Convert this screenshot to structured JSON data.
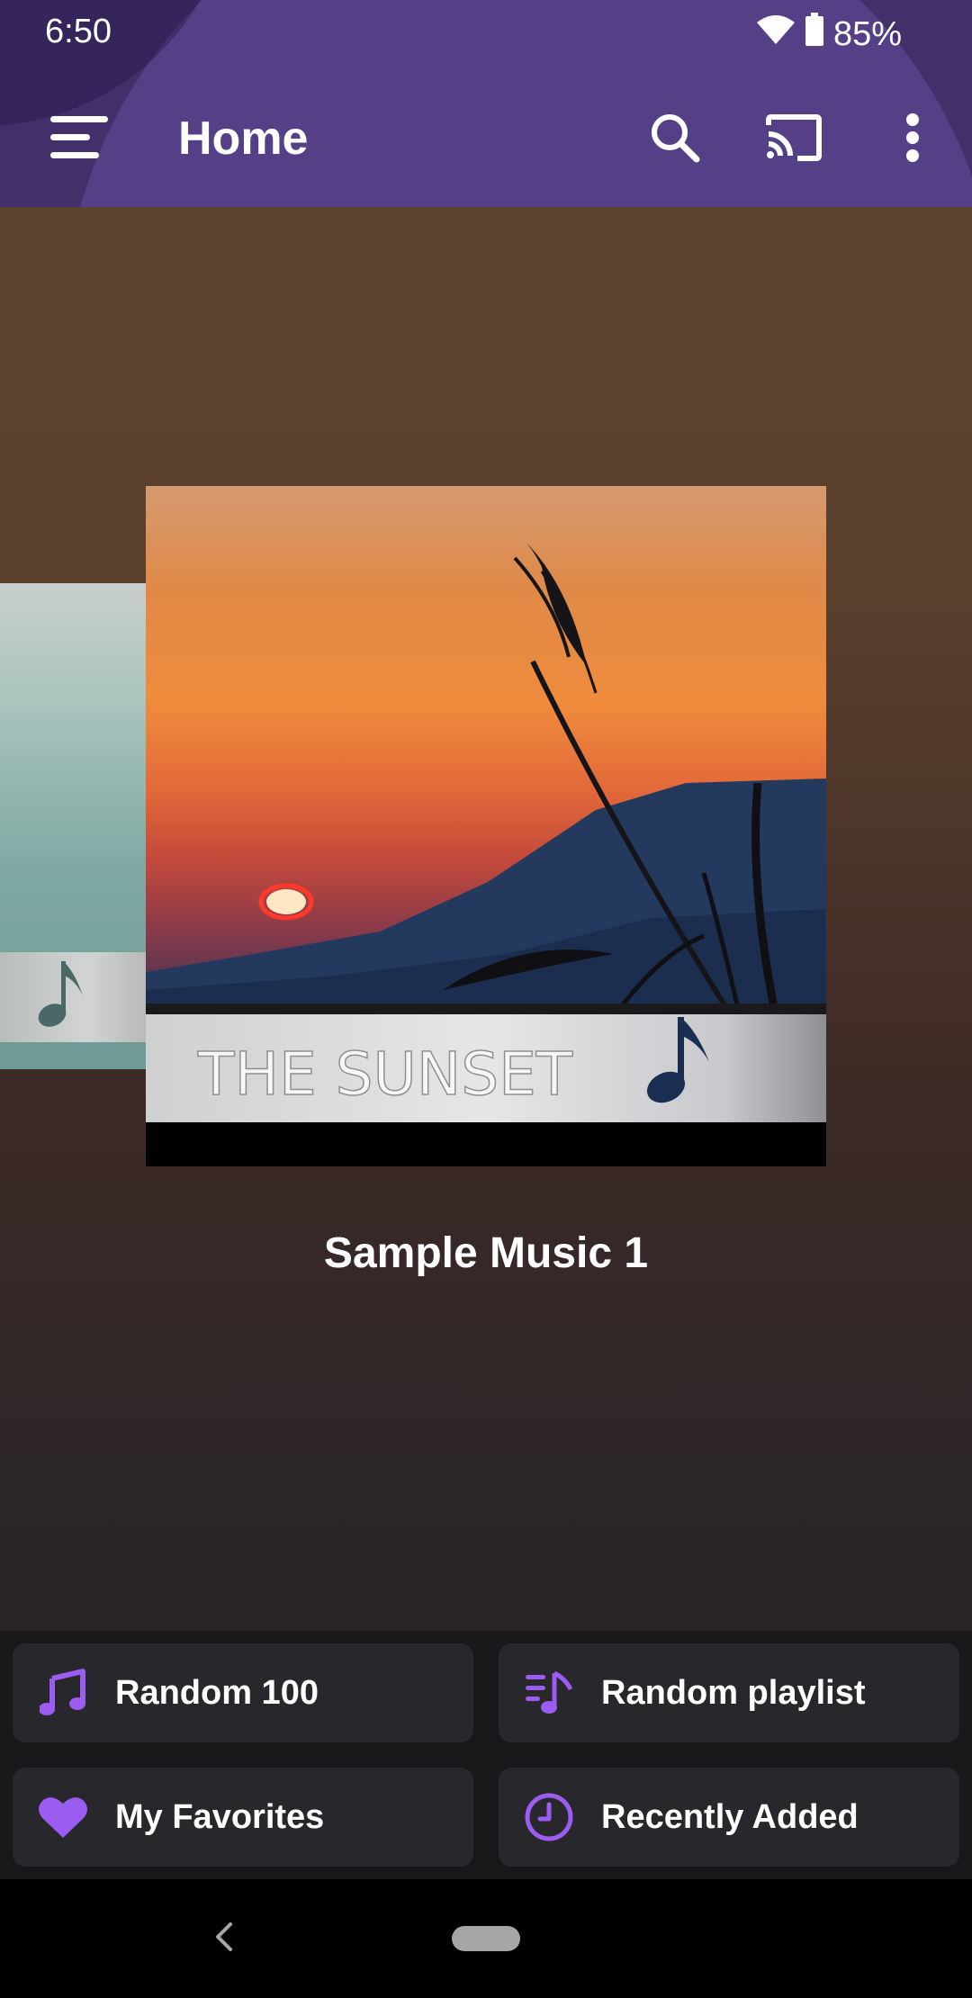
{
  "status_bar": {
    "time": "6:50",
    "battery": "85%",
    "icons": [
      "wifi-icon",
      "battery-icon"
    ]
  },
  "toolbar": {
    "title": "Home",
    "icons": [
      "menu-icon",
      "search-icon",
      "cast-icon",
      "more-vert-icon"
    ]
  },
  "carousel": {
    "current_cover_text": "THE SUNSET",
    "album_title": "Sample Music 1"
  },
  "quick_actions": [
    {
      "label": "Random 100",
      "icon": "music-note-icon"
    },
    {
      "label": "Random playlist",
      "icon": "playlist-music-icon"
    },
    {
      "label": "My Favorites",
      "icon": "heart-icon"
    },
    {
      "label": "Recently Added",
      "icon": "clock-icon"
    }
  ],
  "colors": {
    "app_bar": "#432f6a",
    "accent": "#9b5cf2",
    "tile_background": "#28272b",
    "page_gradient_top": "#5f4530",
    "page_gradient_bottom": "#222224"
  }
}
